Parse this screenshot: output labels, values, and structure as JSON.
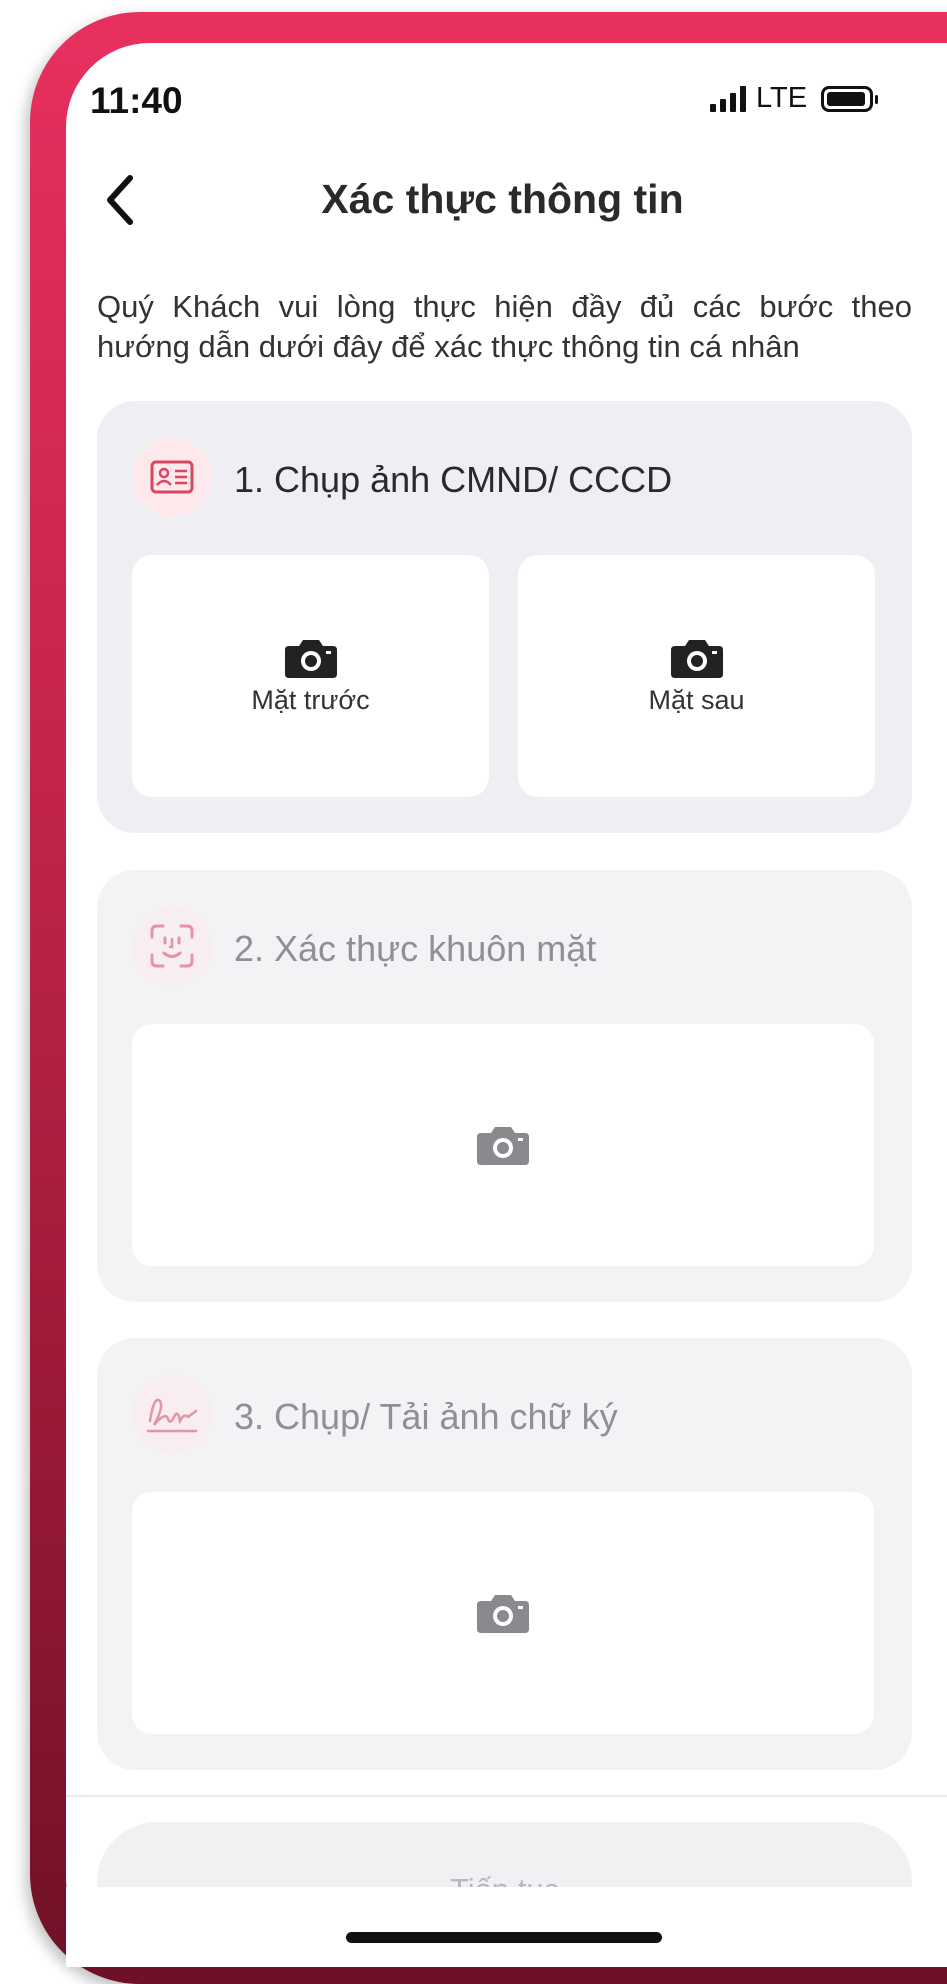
{
  "status_bar": {
    "time": "11:40",
    "network": "LTE"
  },
  "header": {
    "title": "Xác thực thông tin"
  },
  "intro_text": "Quý Khách vui lòng thực hiện đầy đủ các bước theo hướng dẫn dưới đây để xác thực thông tin cá nhân",
  "steps": [
    {
      "title": "1. Chụp ảnh CMND/ CCCD",
      "icon": "id-card-icon",
      "photos": [
        {
          "label": "Mặt trước",
          "icon": "camera-icon"
        },
        {
          "label": "Mặt sau",
          "icon": "camera-icon"
        }
      ]
    },
    {
      "title": "2. Xác thực khuôn mặt",
      "icon": "face-scan-icon",
      "photo_icon": "camera-icon"
    },
    {
      "title": "3. Chụp/ Tải ảnh chữ ký",
      "icon": "signature-icon",
      "photo_icon": "camera-icon"
    }
  ],
  "continue_button": {
    "label": "Tiếp tục"
  },
  "colors": {
    "brand": "#e8305f",
    "brand_dark": "#6e1126",
    "icon_bg": "#fde9ec",
    "card_bg": "#efeff3",
    "disabled_text": "#b8b8bd"
  }
}
